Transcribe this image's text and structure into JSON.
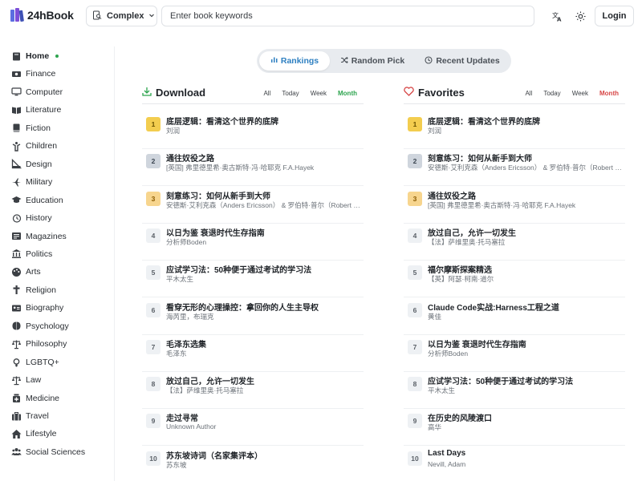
{
  "app": {
    "name": "24hBook",
    "mode_label": "Complex",
    "search_placeholder": "Enter book keywords",
    "login_label": "Login",
    "accent": "#2d7fc1",
    "active_dot_color": "#2da44e"
  },
  "sidebar": {
    "items": [
      {
        "label": "Home",
        "icon": "home-book-icon",
        "active": true
      },
      {
        "label": "Finance",
        "icon": "money-icon"
      },
      {
        "label": "Computer",
        "icon": "monitor-icon"
      },
      {
        "label": "Literature",
        "icon": "book-open-icon"
      },
      {
        "label": "Fiction",
        "icon": "book-icon"
      },
      {
        "label": "Children",
        "icon": "child-icon"
      },
      {
        "label": "Design",
        "icon": "ruler-icon"
      },
      {
        "label": "Military",
        "icon": "jet-icon"
      },
      {
        "label": "Education",
        "icon": "graduation-cap-icon"
      },
      {
        "label": "History",
        "icon": "history-clock-icon"
      },
      {
        "label": "Magazines",
        "icon": "newspaper-icon"
      },
      {
        "label": "Politics",
        "icon": "landmark-icon"
      },
      {
        "label": "Arts",
        "icon": "palette-icon"
      },
      {
        "label": "Religion",
        "icon": "cross-icon"
      },
      {
        "label": "Biography",
        "icon": "id-card-icon"
      },
      {
        "label": "Psychology",
        "icon": "brain-icon"
      },
      {
        "label": "Philosophy",
        "icon": "scale-icon"
      },
      {
        "label": "LGBTQ+",
        "icon": "gender-icon"
      },
      {
        "label": "Law",
        "icon": "gavel-scale-icon"
      },
      {
        "label": "Medicine",
        "icon": "medicine-icon"
      },
      {
        "label": "Travel",
        "icon": "suitcase-icon"
      },
      {
        "label": "Lifestyle",
        "icon": "house-icon"
      },
      {
        "label": "Social Sciences",
        "icon": "people-icon"
      }
    ]
  },
  "tabs": [
    {
      "label": "Rankings",
      "icon": "bar-chart-icon",
      "active": true
    },
    {
      "label": "Random Pick",
      "icon": "shuffle-icon"
    },
    {
      "label": "Recent Updates",
      "icon": "clock-icon"
    }
  ],
  "download": {
    "title": "Download",
    "filters": [
      "All",
      "Today",
      "Week",
      "Month"
    ],
    "active_filter": "Month",
    "active_color": "#2da44e",
    "books": [
      {
        "rank": "1",
        "title": "底层逻辑：看清这个世界的底牌",
        "author": "刘润"
      },
      {
        "rank": "2",
        "title": "通往奴役之路",
        "author": "[英国] 弗里德里希·奥古斯特·冯·哈耶克 F.A.Hayek"
      },
      {
        "rank": "3",
        "title": "刻意练习：如何从新手到大师",
        "author": "安德斯·艾利克森（Anders Ericsson） & 罗伯特·普尔（Robert Pool）"
      },
      {
        "rank": "4",
        "title": "以日为鉴 衰退时代生存指南",
        "author": "分析师Boden"
      },
      {
        "rank": "5",
        "title": "应试学习法：50种便于通过考试的学习法",
        "author": "平木太生"
      },
      {
        "rank": "6",
        "title": "看穿无形的心理操控：拿回你的人生主导权",
        "author": "海芮里，布瑞克"
      },
      {
        "rank": "7",
        "title": "毛泽东选集",
        "author": "毛泽东"
      },
      {
        "rank": "8",
        "title": "放过自己，允许一切发生",
        "author": "【法】萨维里奥·托马塞拉"
      },
      {
        "rank": "9",
        "title": "走过寻常",
        "author": "Unknown Author"
      },
      {
        "rank": "10",
        "title": "苏东坡诗词（名家集评本）",
        "author": "苏东坡"
      }
    ]
  },
  "favorites": {
    "title": "Favorites",
    "filters": [
      "All",
      "Today",
      "Week",
      "Month"
    ],
    "active_filter": "Month",
    "active_color": "#d64545",
    "books": [
      {
        "rank": "1",
        "title": "底层逻辑：看清这个世界的底牌",
        "author": "刘润"
      },
      {
        "rank": "2",
        "title": "刻意练习：如何从新手到大师",
        "author": "安德斯·艾利克森（Anders Ericsson） & 罗伯特·普尔（Robert Pool）"
      },
      {
        "rank": "3",
        "title": "通往奴役之路",
        "author": "[英国] 弗里德里希·奥古斯特·冯·哈耶克 F.A.Hayek"
      },
      {
        "rank": "4",
        "title": "放过自己，允许一切发生",
        "author": "【法】萨维里奥·托马塞拉"
      },
      {
        "rank": "5",
        "title": "福尔摩斯探案精选",
        "author": "【英】阿瑟·柯南·道尔"
      },
      {
        "rank": "6",
        "title": "Claude Code实战:Harness工程之道",
        "author": "黄佳"
      },
      {
        "rank": "7",
        "title": "以日为鉴 衰退时代生存指南",
        "author": "分析师Boden"
      },
      {
        "rank": "8",
        "title": "应试学习法：50种便于通过考试的学习法",
        "author": "平木太生"
      },
      {
        "rank": "9",
        "title": "在历史的风陵渡口",
        "author": "高华"
      },
      {
        "rank": "10",
        "title": "Last Days",
        "author": "Nevill, Adam"
      }
    ]
  }
}
